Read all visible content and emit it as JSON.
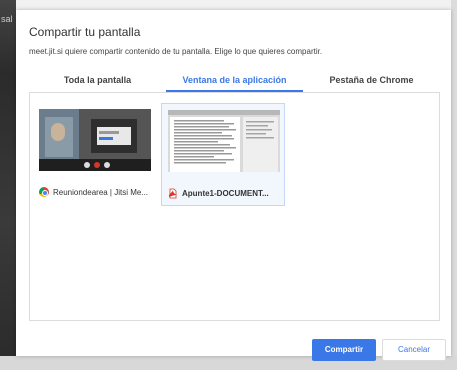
{
  "background": {
    "fragment": "sal"
  },
  "dialog": {
    "title": "Compartir tu pantalla",
    "subtitle": "meet.jit.si quiere compartir contenido de tu pantalla. Elige lo que quieres compartir."
  },
  "tabs": [
    {
      "label": "Toda la pantalla",
      "active": false
    },
    {
      "label": "Ventana de la aplicación",
      "active": true
    },
    {
      "label": "Pestaña de Chrome",
      "active": false
    }
  ],
  "windows": [
    {
      "label": "Reuniondearea | Jitsi Me...",
      "icon": "chrome-icon",
      "selected": false
    },
    {
      "label": "Apunte1-DOCUMENT...",
      "icon": "pdf-icon",
      "selected": true
    }
  ],
  "buttons": {
    "share": "Compartir",
    "cancel": "Cancelar"
  },
  "colors": {
    "accent": "#3b78e7",
    "pdf": "#d9342b"
  }
}
